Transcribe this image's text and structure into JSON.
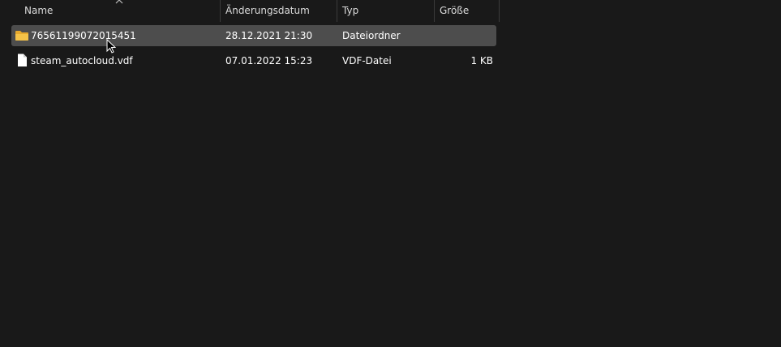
{
  "columns": {
    "name": "Name",
    "modified": "Änderungsdatum",
    "type": "Typ",
    "size": "Größe"
  },
  "files": [
    {
      "name": "76561199072015451",
      "modified": "28.12.2021 21:30",
      "type": "Dateiordner",
      "size": "",
      "icon": "folder-icon",
      "selected": true
    },
    {
      "name": "steam_autocloud.vdf",
      "modified": "07.01.2022 15:23",
      "type": "VDF-Datei",
      "size": "1 KB",
      "icon": "file-icon",
      "selected": false
    }
  ],
  "colors": {
    "background": "#191919",
    "selection": "#4d4d4d",
    "folder": "#f5c348"
  }
}
